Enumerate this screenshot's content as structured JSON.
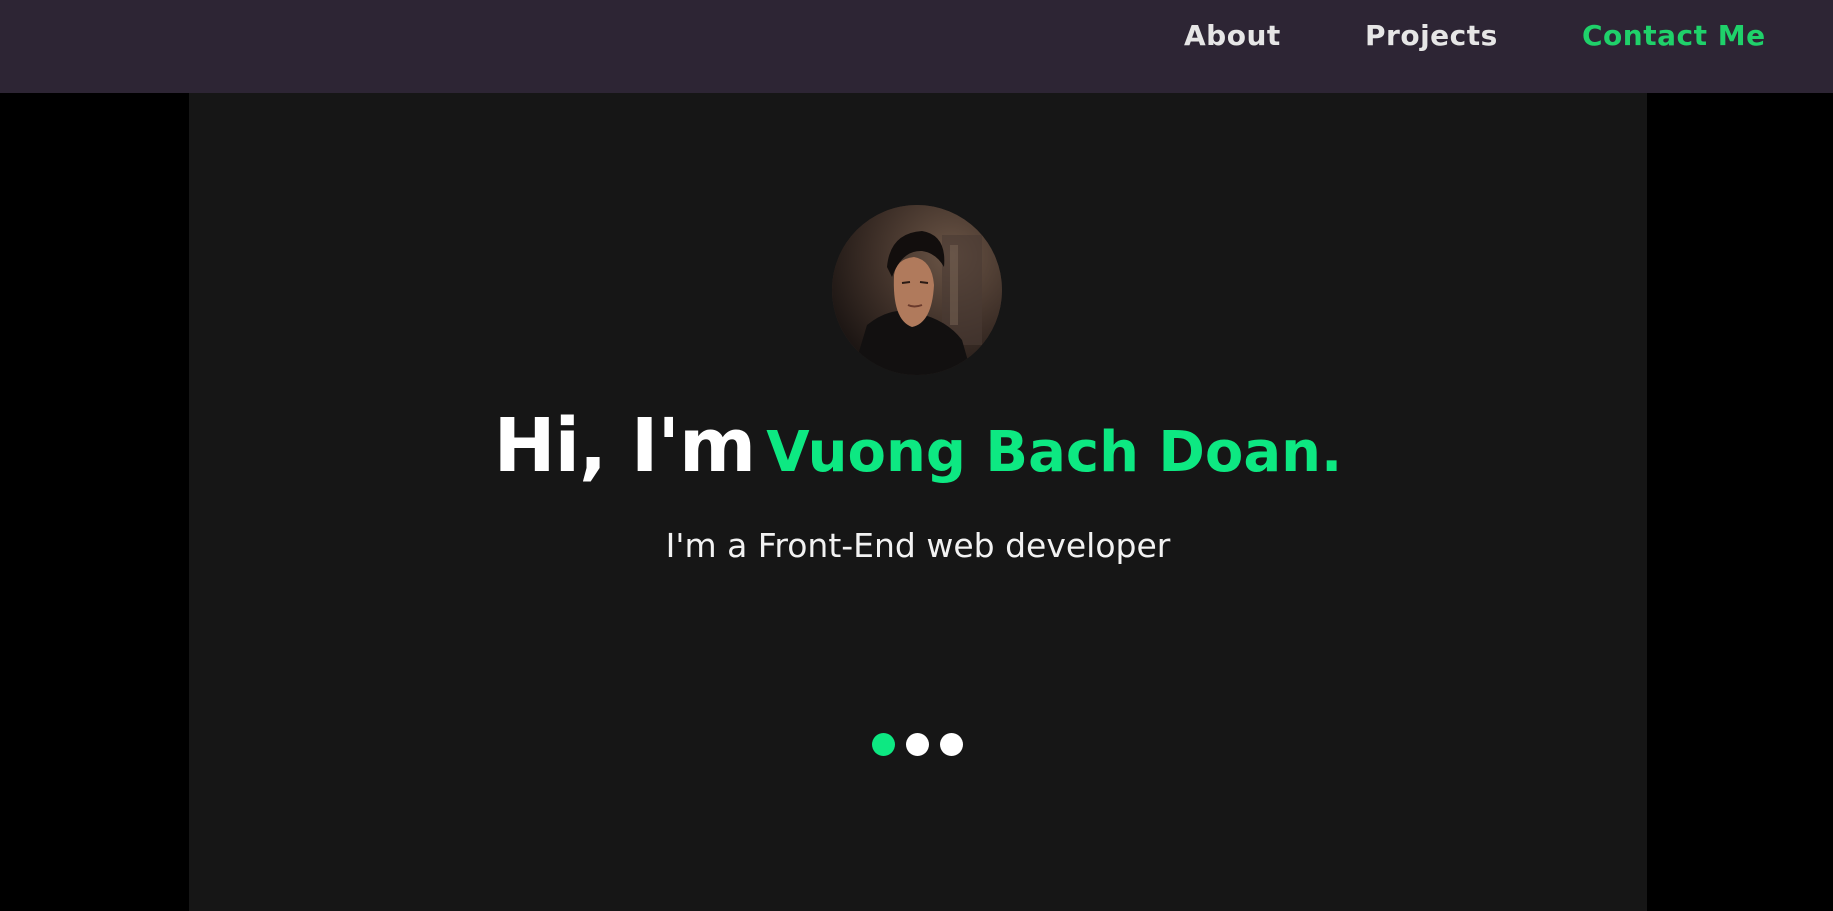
{
  "nav": {
    "about": "About",
    "projects": "Projects",
    "contact": "Contact Me"
  },
  "hero": {
    "greeting": "Hi, I'm",
    "name": "Vuong Bach Doan.",
    "subtitle": "I'm a Front-End web developer",
    "carousel": {
      "slide_count": 3,
      "active_index": 0
    }
  },
  "colors": {
    "navbar_bg": "#2d2534",
    "page_bg": "#000000",
    "hero_bg": "#161616",
    "accent_green": "#0de882",
    "nav_contact_green": "#1fd16a",
    "nav_text": "#e6e6e6"
  }
}
